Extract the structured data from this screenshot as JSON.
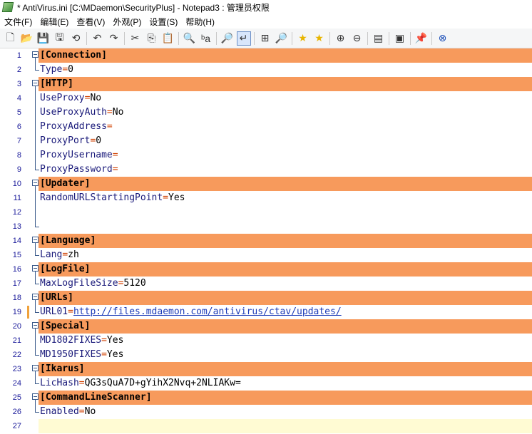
{
  "window": {
    "title": "* AntiVirus.ini [C:\\MDaemon\\SecurityPlus] - Notepad3 : 管理员权限"
  },
  "menu": [
    "文件(F)",
    "编辑(E)",
    "查看(V)",
    "外观(P)",
    "设置(S)",
    "帮助(H)"
  ],
  "toolbar": {
    "buttons": [
      {
        "name": "new-file-icon",
        "glyph": "🗋"
      },
      {
        "name": "open-folder-icon",
        "glyph": "📂"
      },
      {
        "name": "save-icon",
        "glyph": "💾"
      },
      {
        "name": "save-as-icon",
        "glyph": "🖫"
      },
      {
        "name": "revert-icon",
        "glyph": "⟲"
      },
      {
        "sep": true
      },
      {
        "name": "undo-icon",
        "glyph": "↶"
      },
      {
        "name": "redo-icon",
        "glyph": "↷"
      },
      {
        "sep": true
      },
      {
        "name": "cut-icon",
        "glyph": "✂"
      },
      {
        "name": "copy-icon",
        "glyph": "⎘"
      },
      {
        "name": "paste-icon",
        "glyph": "📋"
      },
      {
        "sep": true
      },
      {
        "name": "find-icon",
        "glyph": "🔍"
      },
      {
        "name": "replace-icon",
        "glyph": "ᵇa"
      },
      {
        "sep": true
      },
      {
        "name": "find-in-files-icon",
        "glyph": "🔎"
      },
      {
        "name": "word-wrap-icon",
        "glyph": "↵",
        "active": true
      },
      {
        "sep": true
      },
      {
        "name": "column-select-icon",
        "glyph": "⊞"
      },
      {
        "name": "zoom-find-icon",
        "glyph": "🔎"
      },
      {
        "sep": true
      },
      {
        "name": "favorite-star-icon",
        "glyph": "★",
        "color": "#e8b500"
      },
      {
        "name": "add-favorite-icon",
        "glyph": "★",
        "color": "#e8b500"
      },
      {
        "sep": true
      },
      {
        "name": "zoom-in-icon",
        "glyph": "⊕"
      },
      {
        "name": "zoom-out-icon",
        "glyph": "⊖"
      },
      {
        "sep": true
      },
      {
        "name": "settings-window-icon",
        "glyph": "▤"
      },
      {
        "sep": true
      },
      {
        "name": "terminal-icon",
        "glyph": "▣"
      },
      {
        "sep": true
      },
      {
        "name": "pin-icon",
        "glyph": "📌"
      },
      {
        "sep": true
      },
      {
        "name": "close-icon",
        "glyph": "⊗",
        "color": "#1d4fb8"
      }
    ]
  },
  "colors": {
    "section_bg": "#f79a5c",
    "current_line": "#fffbd3",
    "key": "#1a1a7a",
    "equals": "#d04000",
    "url": "#1b3bb8",
    "line_number": "#1a1a9a"
  },
  "editor": {
    "current_line": 27,
    "lines": [
      {
        "n": "1",
        "type": "section",
        "text": "[Connection]"
      },
      {
        "n": "2",
        "type": "kv",
        "key": "Type",
        "value": "0"
      },
      {
        "n": "3",
        "type": "section",
        "text": "[HTTP]"
      },
      {
        "n": "4",
        "type": "kv",
        "key": "UseProxy",
        "value": "No"
      },
      {
        "n": "5",
        "type": "kv",
        "key": "UseProxyAuth",
        "value": "No"
      },
      {
        "n": "6",
        "type": "kv",
        "key": "ProxyAddress",
        "value": ""
      },
      {
        "n": "7",
        "type": "kv",
        "key": "ProxyPort",
        "value": "0"
      },
      {
        "n": "8",
        "type": "kv",
        "key": "ProxyUsername",
        "value": ""
      },
      {
        "n": "9",
        "type": "kv",
        "key": "ProxyPassword",
        "value": ""
      },
      {
        "n": "10",
        "type": "section",
        "text": "[Updater]"
      },
      {
        "n": "11",
        "type": "kv",
        "key": "RandomURLStartingPoint",
        "value": "Yes"
      },
      {
        "n": "12",
        "type": "blank"
      },
      {
        "n": "13",
        "type": "blank"
      },
      {
        "n": "14",
        "type": "section",
        "text": "[Language]"
      },
      {
        "n": "15",
        "type": "kv",
        "key": "Lang",
        "value": "zh"
      },
      {
        "n": "16",
        "type": "section",
        "text": "[LogFile]"
      },
      {
        "n": "17",
        "type": "kv",
        "key": "MaxLogFileSize",
        "value": "5120"
      },
      {
        "n": "18",
        "type": "section",
        "text": "[URLs]"
      },
      {
        "n": "19",
        "type": "kv",
        "key": "URL01",
        "value": "http://files.mdaemon.com/antivirus/ctav/updates/",
        "url": true,
        "changed": true
      },
      {
        "n": "20",
        "type": "section",
        "text": "[Special]"
      },
      {
        "n": "21",
        "type": "kv",
        "key": "MD1802FIXES",
        "value": "Yes"
      },
      {
        "n": "22",
        "type": "kv",
        "key": "MD1950FIXES",
        "value": "Yes"
      },
      {
        "n": "23",
        "type": "section",
        "text": "[Ikarus]"
      },
      {
        "n": "24",
        "type": "kv",
        "key": "LicHash",
        "value": "QG3sQuA7D+gYihX2Nvq+2NLIAKw="
      },
      {
        "n": "25",
        "type": "section",
        "text": "[CommandLineScanner]"
      },
      {
        "n": "26",
        "type": "kv",
        "key": "Enabled",
        "value": "No"
      },
      {
        "n": "27",
        "type": "blank"
      }
    ]
  }
}
